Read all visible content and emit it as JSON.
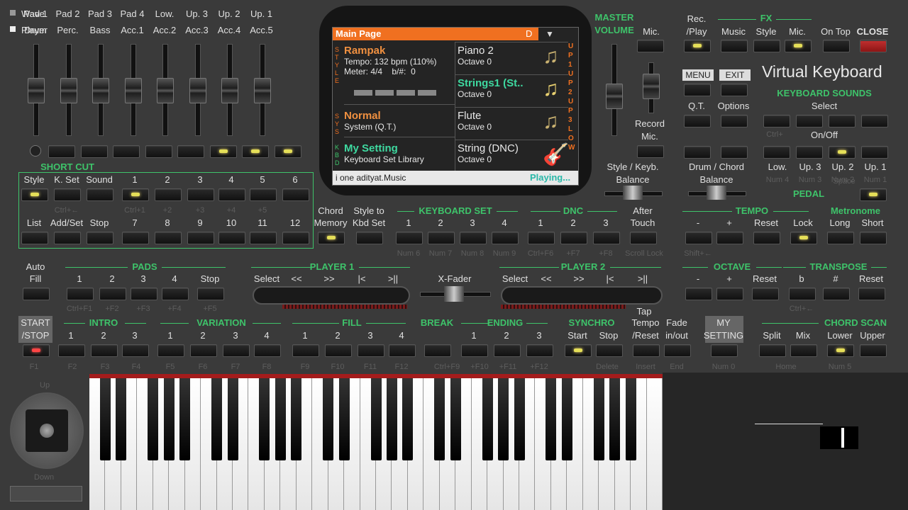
{
  "top_left_rows": {
    "row1": "Wave",
    "row2": "Player"
  },
  "mixer": {
    "top": [
      "Pad 1",
      "Pad 2",
      "Pad 3",
      "Pad 4",
      "Low.",
      "Up. 3",
      "Up. 2",
      "Up. 1"
    ],
    "bottom": [
      "Drum",
      "Perc.",
      "Bass",
      "Acc.1",
      "Acc.2",
      "Acc.3",
      "Acc.4",
      "Acc.5"
    ]
  },
  "shortcut": {
    "title": "SHORT CUT",
    "row1": [
      "Style",
      "K. Set",
      "Sound",
      "1",
      "2",
      "3",
      "4",
      "5",
      "6"
    ],
    "row1_keys": [
      "Ctrl+←",
      "Ctrl+1",
      "+2",
      "+3",
      "+4",
      "+5"
    ],
    "row2": [
      "List",
      "Add/Set",
      "Stop",
      "7",
      "8",
      "9",
      "10",
      "11",
      "12"
    ]
  },
  "screen": {
    "header": "Main Page",
    "header_right": "D",
    "style_name": "Rampak",
    "tempo": "Tempo: 132 bpm (110%)",
    "meter": "Meter: 4/4",
    "bsharp": "b/#:",
    "bsharp_val": "0",
    "sys_name": "Normal",
    "sys_sub": "System (Q.T.)",
    "kbd_name": "My Setting",
    "kbd_sub": "Keyboard Set Library",
    "voices": [
      {
        "name": "Piano 2",
        "oct": "Octave 0"
      },
      {
        "name": "Strings1 (St..",
        "oct": "Octave 0"
      },
      {
        "name": "Flute",
        "oct": "Octave 0"
      },
      {
        "name": "String (DNC)",
        "oct": "Octave 0"
      }
    ],
    "footer_left": "i one adityat.Music",
    "footer_right": "Playing...",
    "side_left": "STYLE",
    "side_left2": "SYS",
    "side_left3": "KBD",
    "side_right": "UP1 UP2 UP3 LOW"
  },
  "master": {
    "title1": "MASTER",
    "title2": "VOLUME",
    "mic": "Mic.",
    "record": "Record",
    "record2": "Mic."
  },
  "right": {
    "rec": "Rec.",
    "play": "/Play",
    "fx": "FX",
    "music": "Music",
    "style": "Style",
    "mic": "Mic.",
    "ontop": "On Top",
    "close": "CLOSE",
    "menu": "MENU",
    "exit": "EXIT",
    "title": "Virtual Keyboard",
    "kbd_sounds": "KEYBOARD SOUNDS",
    "qt": "Q.T.",
    "options": "Options",
    "select": "Select",
    "ctrl": "Ctrl+",
    "onoff": "On/Off",
    "parts": [
      "Low.",
      "Up. 3",
      "Up. 2",
      "Up. 1"
    ],
    "parts_keys": [
      "Num 4",
      "Num 3",
      "Num 2",
      "Num 1"
    ],
    "pedal": "PEDAL",
    "space": "Space"
  },
  "balance": {
    "sk": "Style / Keyb.",
    "bal": "Balance",
    "dc": "Drum / Chord",
    "bal2": "Balance"
  },
  "row_mid": {
    "chord": "Chord",
    "memory": "Memory",
    "styleto": "Style to",
    "kbdset": "Kbd Set",
    "kset_title": "KEYBOARD SET",
    "kset": [
      "1",
      "2",
      "3",
      "4"
    ],
    "kset_keys": [
      "Num 6",
      "Num 7",
      "Num 8",
      "Num 9"
    ],
    "dnc_title": "DNC",
    "dnc": [
      "1",
      "2",
      "3"
    ],
    "dnc_keys": [
      "Ctrl+F6",
      "+F7",
      "+F8"
    ],
    "scroll": "Scroll Lock",
    "after": "After",
    "touch": "Touch",
    "tempo_title": "TEMPO",
    "tempo": [
      "-",
      "+",
      "Reset",
      "Lock"
    ],
    "tempo_keys": "Shift+←",
    "metro_title": "Metronome",
    "metro": [
      "Long",
      "Short"
    ]
  },
  "pads": {
    "auto": "Auto",
    "fill": "Fill",
    "title": "PADS",
    "items": [
      "1",
      "2",
      "3",
      "4",
      "Stop"
    ],
    "keys": [
      "Ctrl+F1",
      "+F2",
      "+F3",
      "+F4",
      "+F5"
    ]
  },
  "player1": {
    "title": "PLAYER 1",
    "items": [
      "Select",
      "<<",
      ">>",
      "|<",
      ">||"
    ]
  },
  "player2": {
    "title": "PLAYER 2",
    "items": [
      "Select",
      "<<",
      ">>",
      "|<",
      ">||"
    ]
  },
  "xfader": "X-Fader",
  "tap": "Tap",
  "octave": {
    "title": "OCTAVE",
    "items": [
      "-",
      "+",
      "Reset"
    ]
  },
  "transpose": {
    "title": "TRANSPOSE",
    "items": [
      "b",
      "#",
      "Reset"
    ],
    "keys": "Ctrl+←"
  },
  "bottom": {
    "start": "START",
    "stop": "/STOP",
    "intro": "INTRO",
    "intro_items": [
      "1",
      "2",
      "3"
    ],
    "variation": "VARIATION",
    "variation_items": [
      "1",
      "2",
      "3",
      "4"
    ],
    "fill": "FILL",
    "fill_items": [
      "1",
      "2",
      "3",
      "4"
    ],
    "break": "BREAK",
    "ending": "ENDING",
    "ending_items": [
      "1",
      "2",
      "3"
    ],
    "synchro": "SYNCHRO",
    "sync_items": [
      "Start",
      "Stop"
    ],
    "tempo1": "Tempo",
    "tempo2": "/Reset",
    "fade1": "Fade",
    "fade2": "in/out",
    "my1": "MY",
    "my2": "SETTING",
    "chordscan": "CHORD SCAN",
    "cs_items": [
      "Split",
      "Mix",
      "Lower",
      "Upper"
    ],
    "keys": [
      "F1",
      "F2",
      "F3",
      "F4",
      "F5",
      "F6",
      "F7",
      "F8",
      "F9",
      "F10",
      "F11",
      "F12",
      "Ctrl+F9",
      "+F10",
      "+F11",
      "+F12",
      "Delete",
      "Insert",
      "End",
      "Num 0",
      "Home",
      "Num 5"
    ]
  },
  "joystick": {
    "up": "Up",
    "down": "Down"
  }
}
